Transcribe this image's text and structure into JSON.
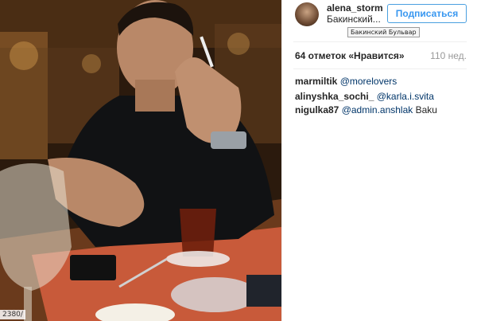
{
  "post": {
    "photo_url_fragment": "2380/"
  },
  "author": {
    "username": "alena_storm",
    "location": "Бакинский...",
    "location_full": "Бакинский Бульвар"
  },
  "follow_button": {
    "label": "Подписаться"
  },
  "stats": {
    "likes": "64 отметок «Нравится»",
    "time_ago": "110 нед."
  },
  "comments": [
    {
      "user": "marmiltik",
      "mention": "@morelovers",
      "text": ""
    },
    {
      "user": "alinyshka_sochi_",
      "mention": "@karla.i.svita",
      "text": ""
    },
    {
      "user": "nigulka87",
      "mention": "@admin.anshlak",
      "text": "Baku"
    }
  ],
  "colors": {
    "accent": "#3897f0",
    "mention": "#003569",
    "muted": "#999999"
  }
}
